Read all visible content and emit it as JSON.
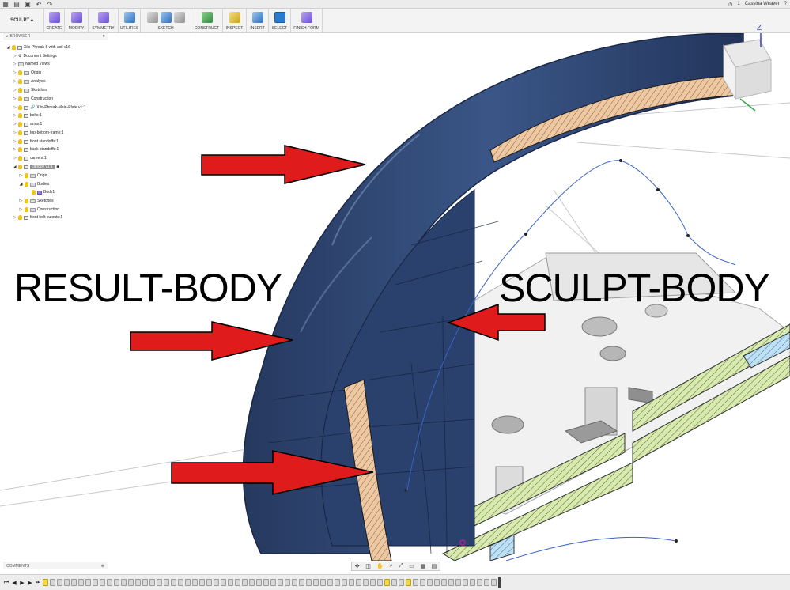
{
  "titlebar": {
    "user": "Cassina Weaver",
    "notifications": "1"
  },
  "ribbon": {
    "workspace": "SCULPT",
    "groups": [
      {
        "label": "CREATE"
      },
      {
        "label": "MODIFY"
      },
      {
        "label": "SYMMETRY"
      },
      {
        "label": "UTILITIES"
      },
      {
        "label": "SKETCH"
      },
      {
        "label": "CONSTRUCT"
      },
      {
        "label": "INSPECT"
      },
      {
        "label": "INSERT"
      },
      {
        "label": "SELECT"
      },
      {
        "label": "FINISH FORM"
      }
    ]
  },
  "browser": {
    "title": "BROWSER",
    "items": [
      {
        "label": "Xilo-Phreak-5 with axil v16"
      },
      {
        "label": "Document Settings"
      },
      {
        "label": "Named Views"
      },
      {
        "label": "Origin"
      },
      {
        "label": "Analysis"
      },
      {
        "label": "Sketches"
      },
      {
        "label": "Construction"
      },
      {
        "label": "Xilo-Phreak-Main-Plate v1:1"
      },
      {
        "label": "bolts:1"
      },
      {
        "label": "arms:1"
      },
      {
        "label": "top-bottom-frame:1"
      },
      {
        "label": "front standoffs:1"
      },
      {
        "label": "back standoffs:1"
      },
      {
        "label": "camera:1"
      },
      {
        "label": "canopy v1:1"
      },
      {
        "label": "Origin"
      },
      {
        "label": "Bodies"
      },
      {
        "label": "Body1"
      },
      {
        "label": "Sketches"
      },
      {
        "label": "Construction"
      },
      {
        "label": "front bolt cutouts:1"
      }
    ]
  },
  "annotations": {
    "left": "RESULT-BODY",
    "right": "SCULPT-BODY"
  },
  "viewcube": {
    "axis_label": "Z"
  },
  "comments": {
    "label": "COMMENTS"
  },
  "colors": {
    "body_blue": "#2e4677",
    "section_tan": "#edc9a3",
    "plate_green": "#d9eab0",
    "arrow_red": "#e01b1b"
  }
}
